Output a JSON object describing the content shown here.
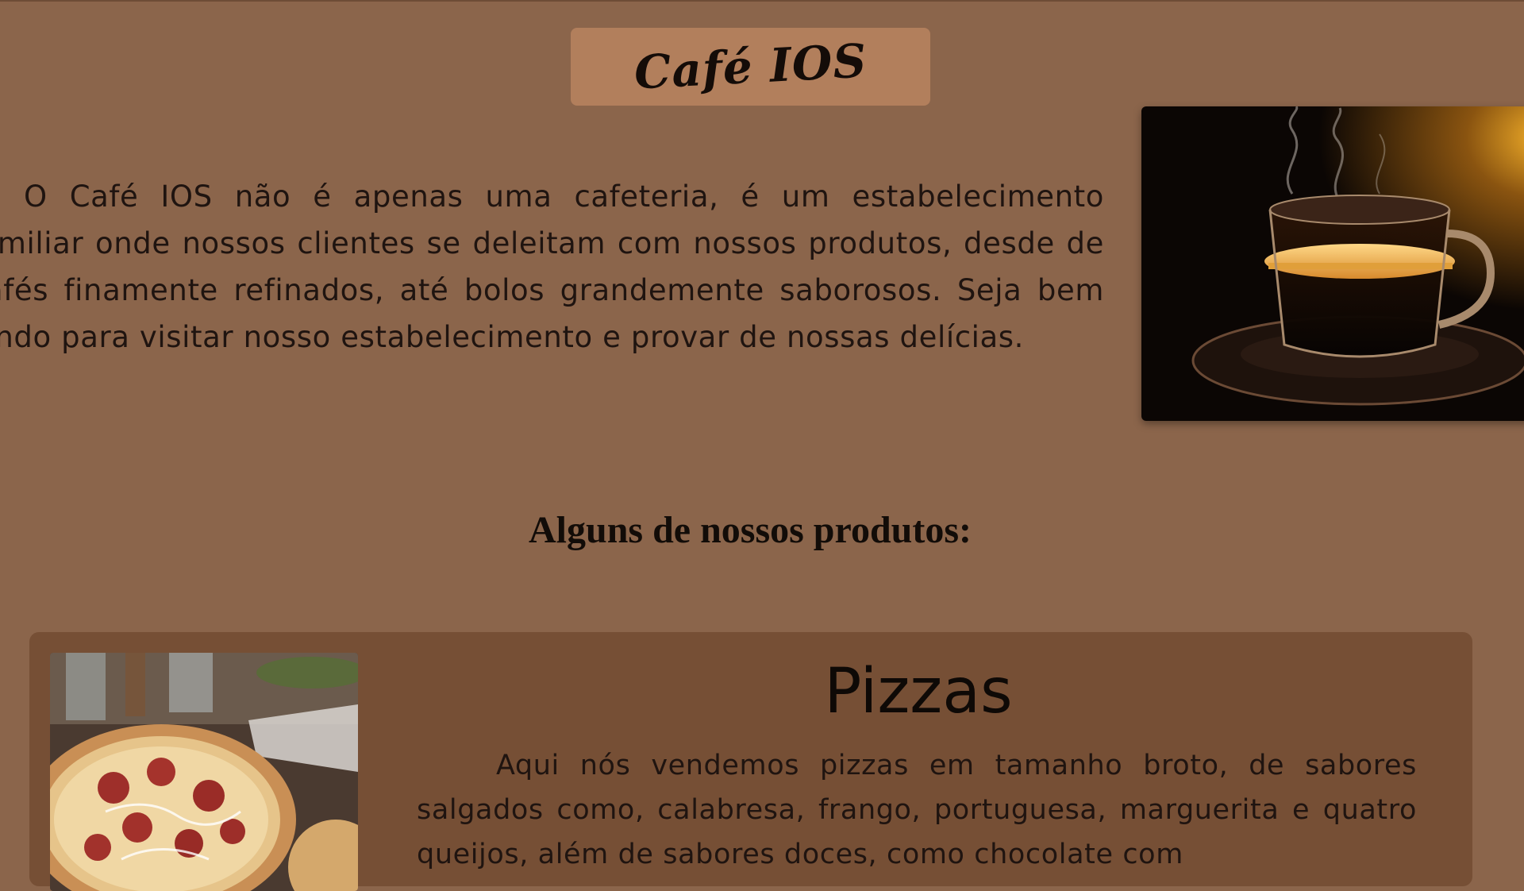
{
  "header": {
    "title": "Café IOS"
  },
  "intro": {
    "text": "O Café IOS não é apenas uma cafeteria, é um estabelecimento familiar onde nossos clientes se deleitam com nossos produtos, desde de cafés finamente refinados, até bolos grandemente saborosos. Seja bem vindo para visitar nosso estabelecimento e provar de nossas delícias."
  },
  "hero_image": {
    "icon": "coffee-cup-image"
  },
  "products": {
    "heading": "Alguns de nossos produtos:",
    "items": [
      {
        "title": "Pizzas",
        "icon": "pizza-image",
        "text": "Aqui nós vendemos pizzas em tamanho broto, de sabores salgados como, calabresa, frango, portuguesa, marguerita e quatro queijos, além de sabores doces, como chocolate com"
      }
    ]
  },
  "colors": {
    "page_background": "#8b654b",
    "title_box": "#b27f5c",
    "card_background": "#764f35",
    "text": "#1f1410"
  }
}
